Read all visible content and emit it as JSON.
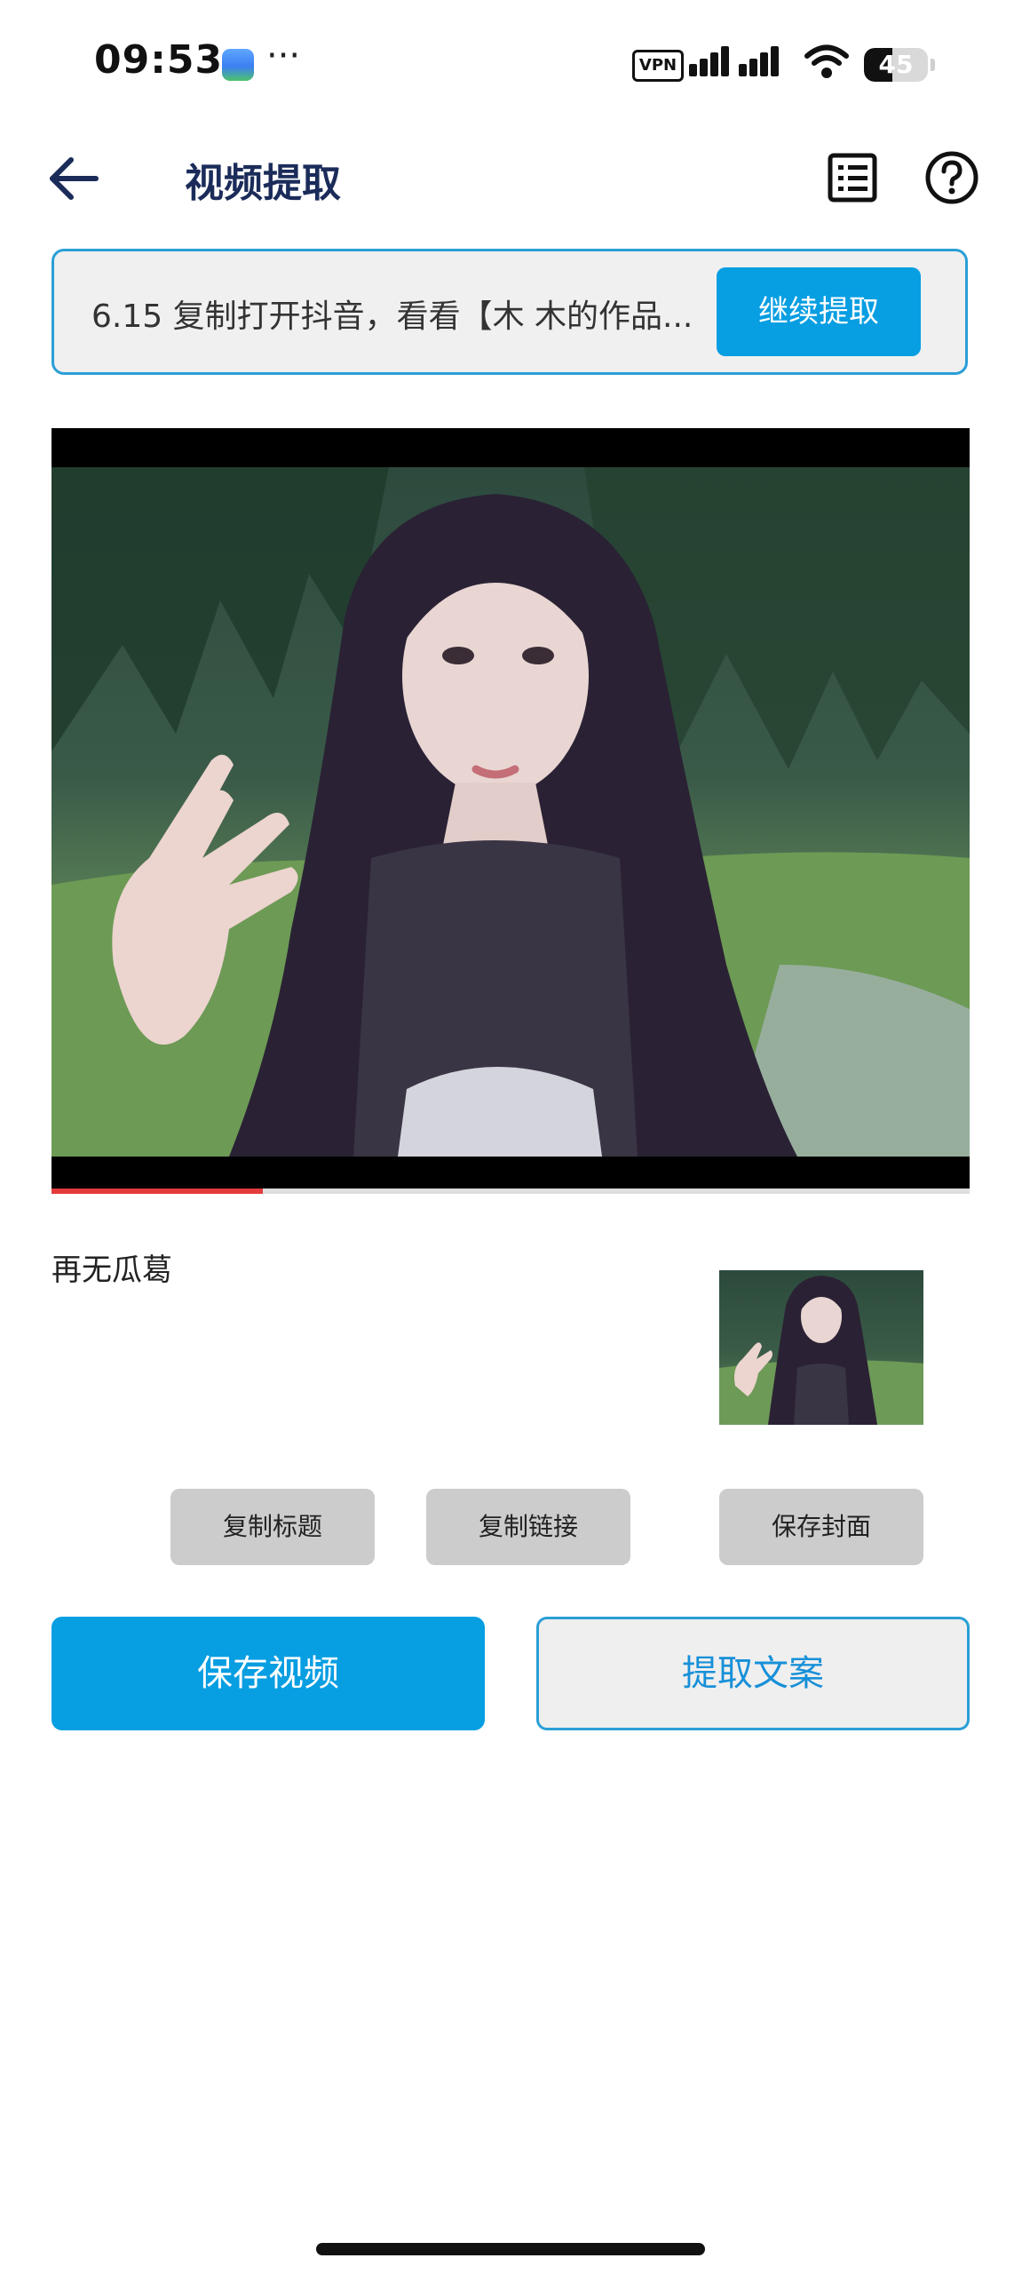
{
  "status_bar": {
    "time": "09:53",
    "vpn_label": "VPN",
    "battery_level": "45",
    "battery_fraction": 0.45,
    "notification_app_icon": "gallery-icon",
    "more_indicator": "···"
  },
  "header": {
    "title": "视频提取",
    "back_icon": "arrow-left-icon",
    "list_icon": "list-icon",
    "help_icon": "help-circle-icon",
    "title_color": "#1b2c5a"
  },
  "link_input": {
    "value": "6.15 复制打开抖音，看看【木 木的作品...",
    "button_label": "继续提取"
  },
  "video_player": {
    "progress_fraction": 0.23,
    "progress_color": "#e23b3b"
  },
  "video_info": {
    "title": "再无瓜葛"
  },
  "actions": {
    "copy_title": "复制标题",
    "copy_link": "复制链接",
    "save_cover": "保存封面",
    "save_video": "保存视频",
    "extract_text": "提取文案"
  },
  "colors": {
    "accent": "#079ee2",
    "accent_border": "#2a9fd6"
  }
}
